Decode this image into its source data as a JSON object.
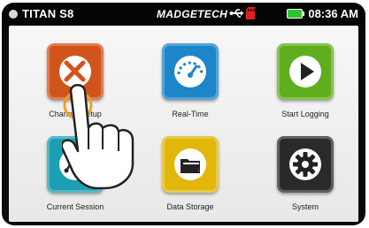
{
  "status": {
    "device_name": "TITAN S8",
    "brand": "MADGETECH",
    "time": "08:36 AM",
    "battery_color": "#2bc82b",
    "sd_color": "#e02020"
  },
  "tiles": [
    {
      "label": "Channel Setup",
      "color": "#d2541d",
      "icon": "tools-icon"
    },
    {
      "label": "Real-Time",
      "color": "#1c86c8",
      "icon": "gauge-icon"
    },
    {
      "label": "Start Logging",
      "color": "#5fae1e",
      "icon": "play-icon"
    },
    {
      "label": "Current Session",
      "color": "#1c9fb4",
      "icon": "graph-icon"
    },
    {
      "label": "Data Storage",
      "color": "#e2b70b",
      "icon": "folder-icon"
    },
    {
      "label": "System",
      "color": "#2a2a2a",
      "icon": "gear-icon"
    }
  ]
}
